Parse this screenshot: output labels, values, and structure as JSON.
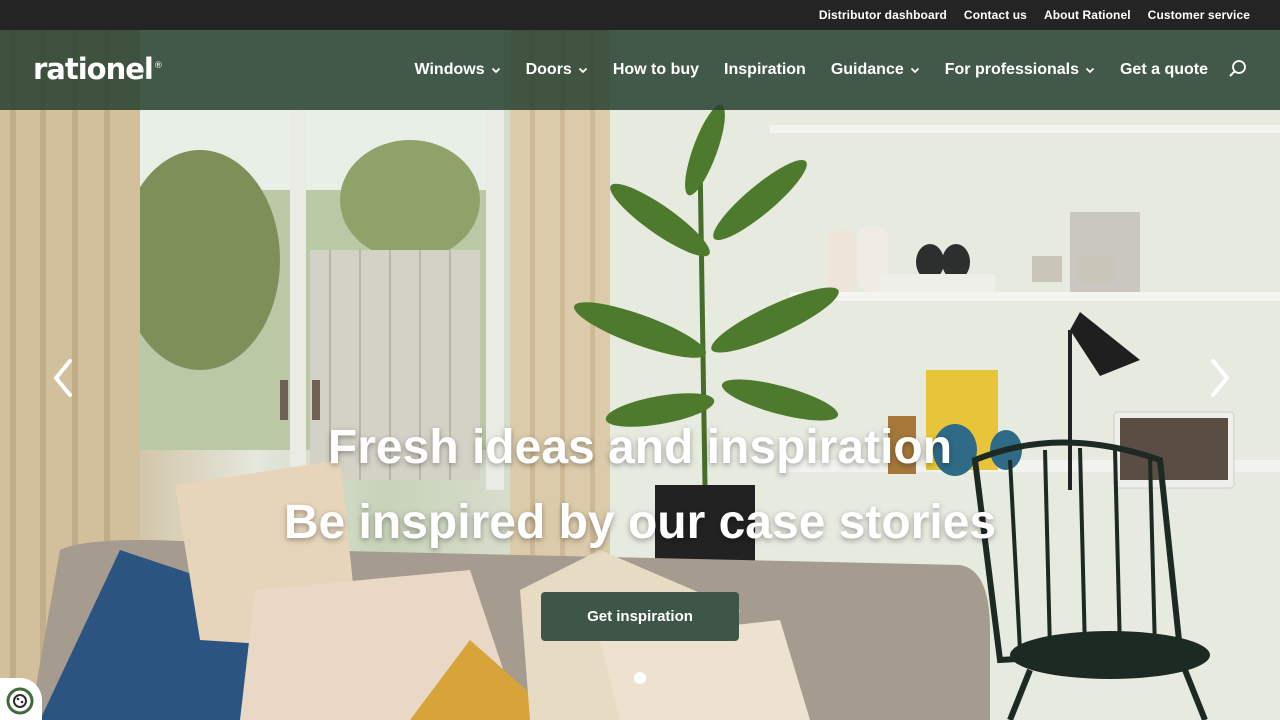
{
  "topbar": {
    "links": [
      "Distributor dashboard",
      "Contact us",
      "About Rationel",
      "Customer service"
    ]
  },
  "brand": {
    "logo_text": "rationel",
    "logo_mark": "®"
  },
  "nav": {
    "items": [
      {
        "label": "Windows",
        "has_dropdown": true
      },
      {
        "label": "Doors",
        "has_dropdown": true
      },
      {
        "label": "How to buy",
        "has_dropdown": false
      },
      {
        "label": "Inspiration",
        "has_dropdown": false
      },
      {
        "label": "Guidance",
        "has_dropdown": true
      },
      {
        "label": "For professionals",
        "has_dropdown": true
      },
      {
        "label": "Get a quote",
        "has_dropdown": false
      }
    ],
    "search_icon": "search-icon"
  },
  "hero": {
    "headline": "Fresh ideas and inspiration",
    "subheadline": "Be inspired by our case stories",
    "cta_label": "Get inspiration",
    "slide_count": 1,
    "active_slide": 1
  },
  "colors": {
    "topbar": "#242424",
    "nav_overlay": "#264030",
    "cta": "#3d5647",
    "text": "#ffffff"
  }
}
